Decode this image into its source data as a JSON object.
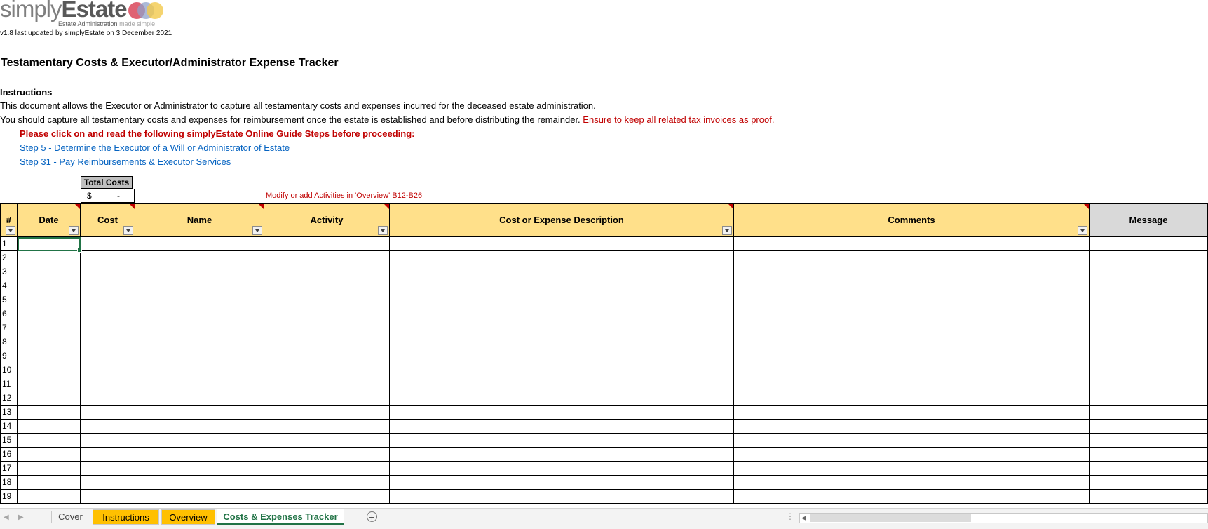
{
  "logo": {
    "word_light": "simply",
    "word_bold": "Estate",
    "tagline_main": "Estate Administration",
    "tagline_sub": "made simple"
  },
  "version_note": "v1.8 last updated by simplyEstate on 3 December 2021",
  "title": "Testamentary Costs & Executor/Administrator Expense Tracker",
  "instructions": {
    "heading": "Instructions",
    "line1": "This document allows the Executor or Administrator to capture all testamentary costs and expenses incurred for the deceased estate administration.",
    "line2": "You should capture all testamentary costs and expenses for reimbursement once the estate is established and before distributing the remainder. ",
    "line2_red": "Ensure to keep all related tax invoices as proof.",
    "guide_prompt": "Please click on and read the following simplyEstate Online Guide Steps before proceeding:",
    "links": [
      "Step 5 - Determine the Executor of a Will or Administrator of Estate",
      "Step 31 - Pay Reimbursements & Executor Services"
    ]
  },
  "total_costs": {
    "label": "Total Costs",
    "currency": "$",
    "value": "-"
  },
  "modify_note": "Modify or add Activities in 'Overview' B12-B26",
  "table": {
    "headers": [
      "#",
      "Date",
      "Cost",
      "Name",
      "Activity",
      "Cost or Expense Description",
      "Comments",
      "Message"
    ],
    "rows": [
      "1",
      "2",
      "3",
      "4",
      "5",
      "6",
      "7",
      "8",
      "9",
      "10",
      "11",
      "12",
      "13",
      "14",
      "15",
      "16",
      "17",
      "18",
      "19"
    ]
  },
  "tabs": {
    "items": [
      "Cover",
      "Instructions",
      "Overview",
      "Costs & Expenses Tracker"
    ],
    "active": "Costs & Expenses Tracker",
    "add_symbol": "+",
    "more_symbol": "⋮"
  },
  "colors": {
    "header_fill": "#ffe08a",
    "accent_red": "#c00000",
    "link_blue": "#0563c1",
    "excel_green": "#217346",
    "tab_yellow": "#ffc000"
  }
}
